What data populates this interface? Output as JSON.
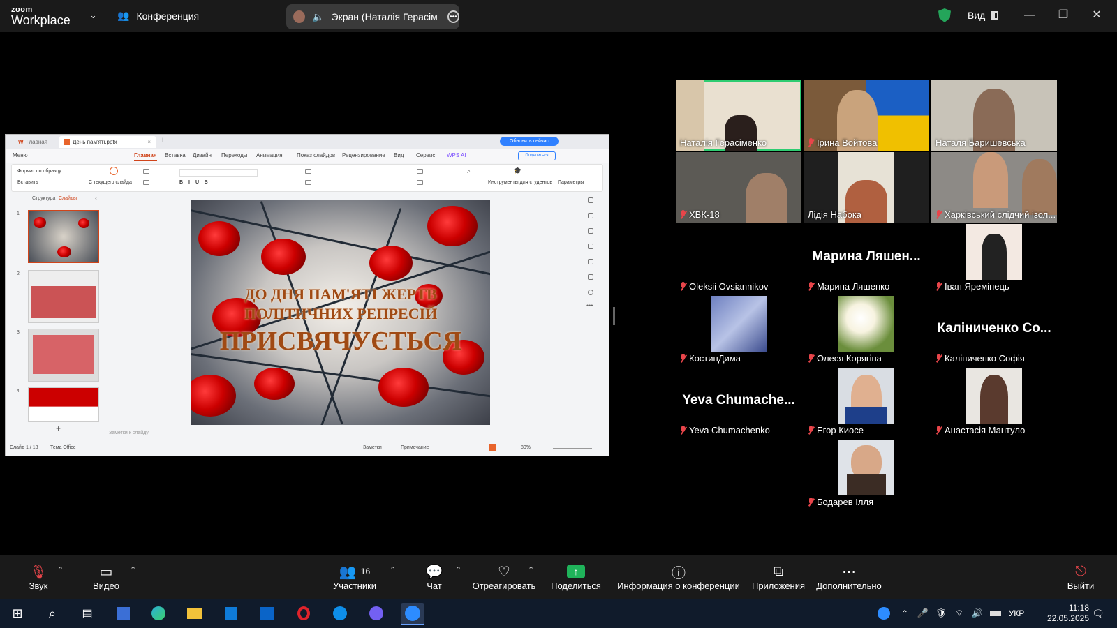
{
  "topbar": {
    "logo_line1": "zoom",
    "logo_line2": "Workplace",
    "meeting_label": "Конференция",
    "sharing_label": "Экран (Наталія Герасіменко)",
    "view_label": "Вид"
  },
  "wps": {
    "tab_home": "Главная",
    "tab_doc": "День пам'яті.pptx",
    "update_btn": "Обновить сейчас",
    "share_btn": "Поделиться",
    "menu": [
      "Меню",
      "Главная",
      "Вставка",
      "Дизайн",
      "Переходы",
      "Анимация",
      "Показ слайдов",
      "Рецензирование",
      "Вид",
      "Сервис",
      "WPS AI"
    ],
    "ribbon": {
      "format_painter": "Формат по образцу",
      "paste": "Вставить",
      "from_current": "С текущего слайда",
      "student_tools": "Инструменты для студентов",
      "params": "Параметры"
    },
    "panel_tabs": [
      "Структура",
      "Слайды"
    ],
    "slide_numbers": [
      "1",
      "2",
      "3",
      "4"
    ],
    "slide_title_line1": "ДО ДНЯ ПАМ'ЯТІ ЖЕРТВ",
    "slide_title_line2": "ПОЛІТИЧНИХ РЕПРЕСІЙ",
    "slide_title_line3": "ПРИСВЯЧУЄТЬСЯ",
    "notes_placeholder": "Заметки к слайду",
    "status": {
      "slide_counter": "Слайд 1 / 18",
      "theme": "Тема Office",
      "notes": "Заметки",
      "comment": "Примечание",
      "zoom": "80%"
    }
  },
  "participants": [
    {
      "name": "Наталія Герасіменко",
      "muted": false,
      "active": true
    },
    {
      "name": "Ірина Войтова",
      "muted": true
    },
    {
      "name": "Наталя Баришевська",
      "muted": false
    },
    {
      "name": "ХВК-18",
      "muted": true
    },
    {
      "name": "Лідія Набока",
      "muted": false
    },
    {
      "name": "Харківський слідчий ізол...",
      "muted": true
    },
    {
      "name": "Oleksii Ovsiannikov",
      "muted": true
    },
    {
      "name": "Марина Ляшенко",
      "muted": true,
      "big": "Марина Ляшен..."
    },
    {
      "name": "Іван Яремінець",
      "muted": true
    },
    {
      "name": "КостинДима",
      "muted": true
    },
    {
      "name": "Олеся Корягіна",
      "muted": true
    },
    {
      "name": "Каліниченко Софія",
      "muted": true,
      "big": "Каліниченко Со..."
    },
    {
      "name": "Yeva Chumachenko",
      "muted": true,
      "big": "Yeva  Chumache..."
    },
    {
      "name": "Егор Киосе",
      "muted": true
    },
    {
      "name": "Анастасія Мантуло",
      "muted": true
    },
    {
      "name": "Бодарев Ілля",
      "muted": true
    }
  ],
  "toolbar": {
    "audio": "Звук",
    "video": "Видео",
    "participants": "Участники",
    "participants_count": "16",
    "chat": "Чат",
    "react": "Отреагировать",
    "share": "Поделиться",
    "info": "Информация о конференции",
    "apps": "Приложения",
    "more": "Дополнительно",
    "leave": "Выйти"
  },
  "taskbar": {
    "language": "УКР",
    "time": "11:18",
    "date": "22.05.2025"
  },
  "colors": {
    "active_speaker": "#2ecc71",
    "muted_icon": "#e8454a",
    "share_green": "#1fb35a",
    "wps_accent": "#d0441a"
  }
}
